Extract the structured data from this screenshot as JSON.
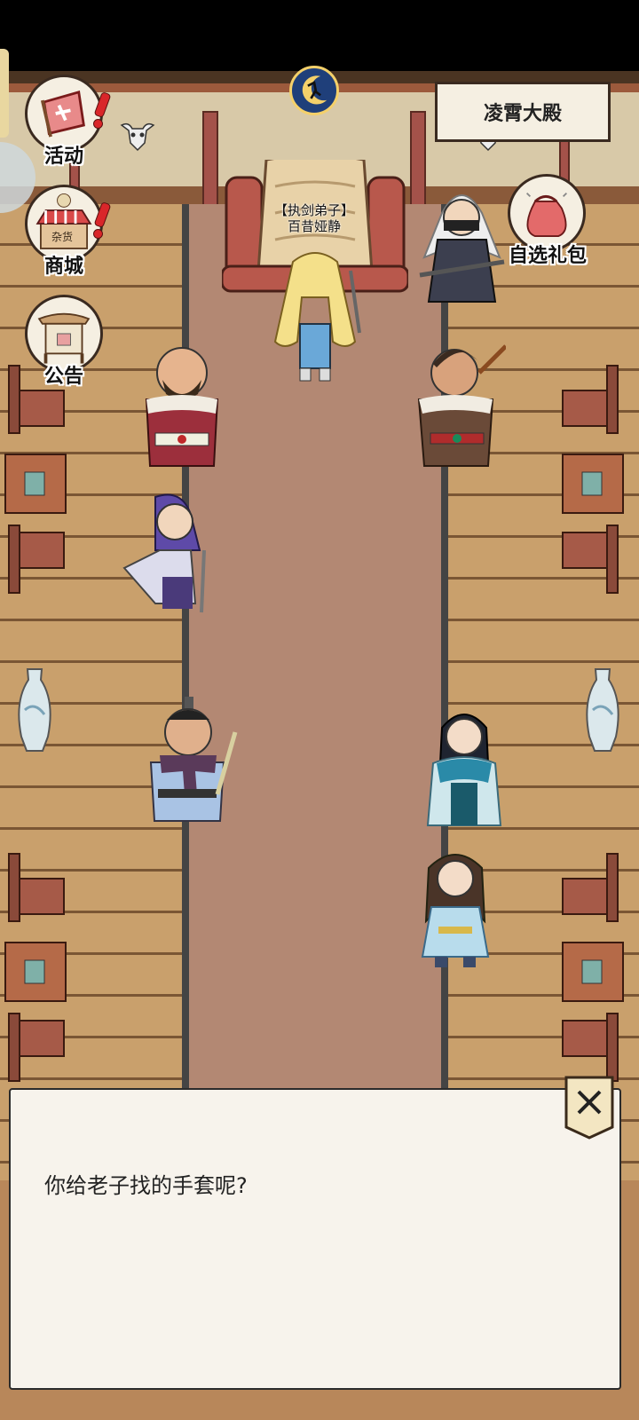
{
  "hall": {
    "title": "凌霄大殿"
  },
  "side_menu": [
    {
      "label": "活动",
      "icon": "event-banner-icon",
      "alert": true
    },
    {
      "label": "商城",
      "icon": "shop-stall-icon",
      "alert": true
    },
    {
      "label": "公告",
      "icon": "notice-board-icon",
      "alert": false
    }
  ],
  "gift_button": {
    "label": "自选礼包",
    "icon": "gift-pouch-icon"
  },
  "top_icon": "night-moon-icon",
  "npc": {
    "title": "【执剑弟子】",
    "name": "百昔娅静"
  },
  "stall_sign": "杂货",
  "dialog": {
    "text": "你给老子找的手套呢?"
  },
  "colors": {
    "alert": "#d9262a",
    "carpet": "#b38873",
    "panel": "#f7f3ec",
    "floor": "#c9a06c"
  }
}
